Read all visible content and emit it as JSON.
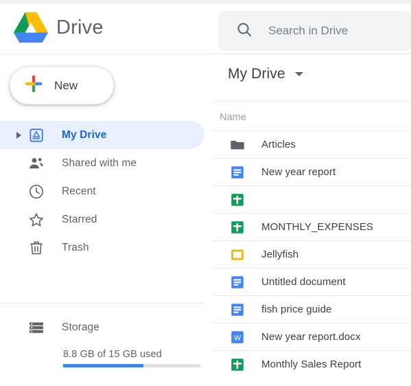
{
  "header": {
    "brand_name": "Drive",
    "logo_icon": "google-drive-logo",
    "search": {
      "icon": "search-icon",
      "placeholder": "Search in Drive",
      "value": ""
    }
  },
  "sidebar": {
    "new_button": {
      "label": "New",
      "icon": "plus-icon"
    },
    "items": [
      {
        "label": "My Drive",
        "icon": "my-drive-icon",
        "active": true,
        "expandable": true
      },
      {
        "label": "Shared with me",
        "icon": "people-icon",
        "active": false,
        "expandable": false
      },
      {
        "label": "Recent",
        "icon": "clock-icon",
        "active": false,
        "expandable": false
      },
      {
        "label": "Starred",
        "icon": "star-icon",
        "active": false,
        "expandable": false
      },
      {
        "label": "Trash",
        "icon": "trash-icon",
        "active": false,
        "expandable": false
      }
    ],
    "storage": {
      "label": "Storage",
      "icon": "storage-icon",
      "usage_text": "8.8 GB of 15 GB used",
      "used_gb": 8.8,
      "total_gb": 15,
      "percent_used": 58.7,
      "bar_color": "#3b85ea",
      "bar_track_color": "#e0e0e0"
    }
  },
  "main": {
    "breadcrumb": {
      "title": "My Drive",
      "caret_icon": "chevron-down-icon"
    },
    "columns": [
      "Name"
    ],
    "files": [
      {
        "name": "Articles",
        "icon": "folder-icon"
      },
      {
        "name": "New year report",
        "icon": "google-docs-icon"
      },
      {
        "name": "",
        "icon": "google-sheets-icon"
      },
      {
        "name": "MONTHLY_EXPENSES",
        "icon": "google-sheets-icon"
      },
      {
        "name": "Jellyfish",
        "icon": "image-file-icon"
      },
      {
        "name": "Untitled document",
        "icon": "google-docs-icon"
      },
      {
        "name": "fish price guide",
        "icon": "google-docs-icon"
      },
      {
        "name": "New year report.docx",
        "icon": "word-doc-icon"
      },
      {
        "name": "Monthly Sales Report",
        "icon": "google-sheets-icon"
      }
    ]
  },
  "colors": {
    "drive_blue": "#4285f4",
    "drive_green": "#0f9d58",
    "drive_yellow": "#f4b400",
    "drive_red": "#db4437",
    "accent_selected": "#1967d2",
    "selected_bg": "#e8f0fe",
    "text_primary": "#3c4043",
    "text_secondary": "#5f6368",
    "folder_gray": "#5f6368"
  }
}
